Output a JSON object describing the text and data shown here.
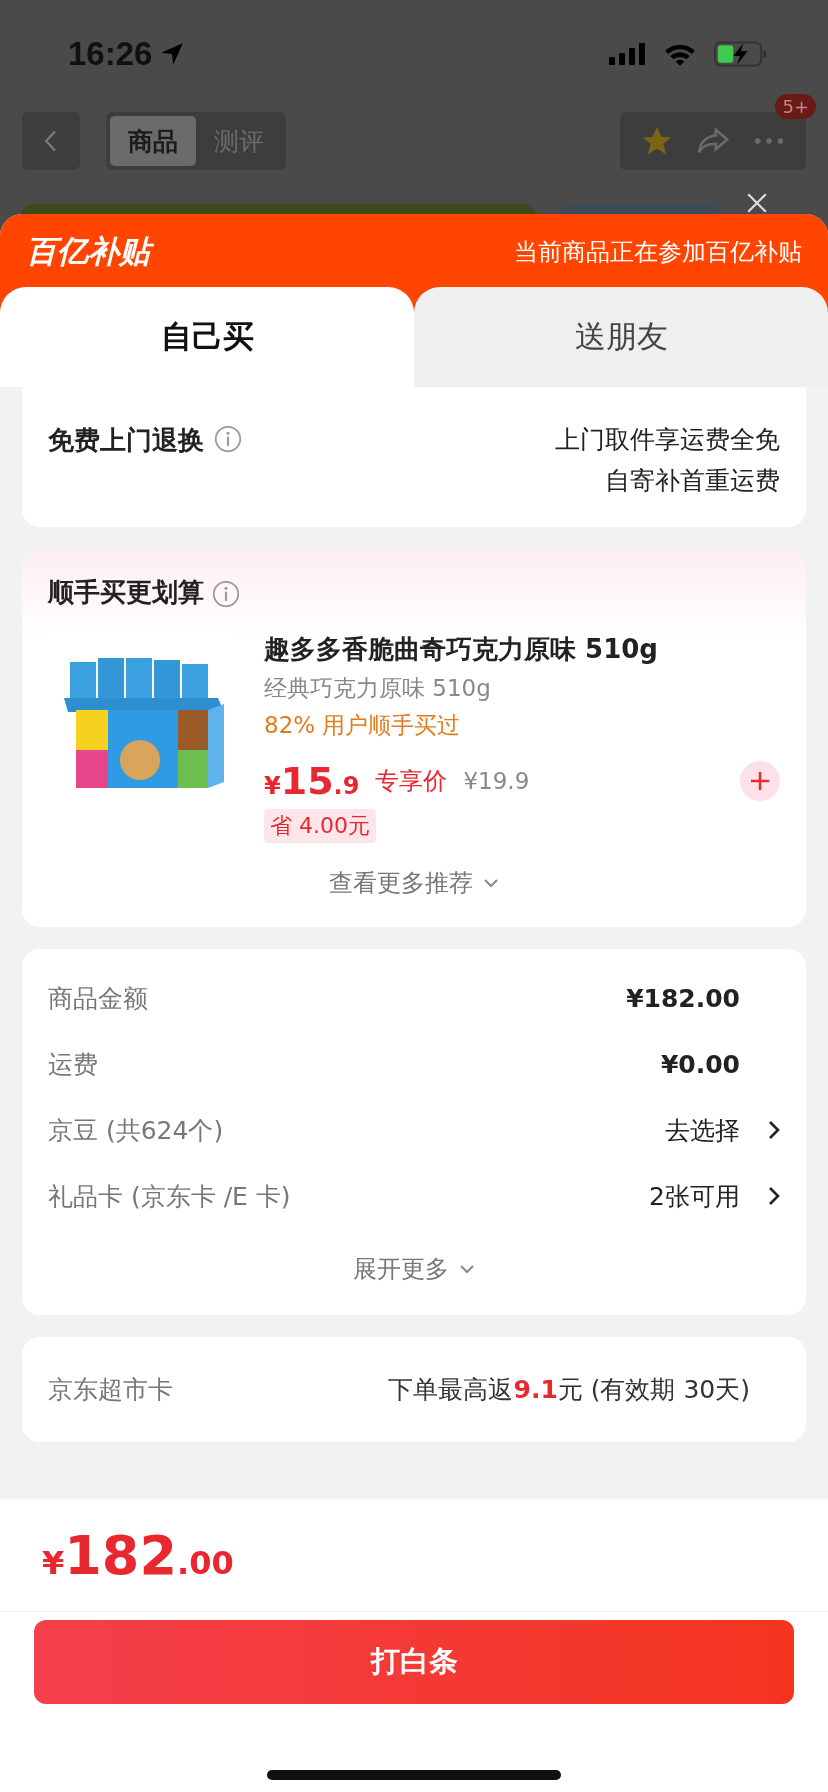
{
  "status_bar": {
    "time": "16:26"
  },
  "nav": {
    "segments": [
      {
        "label": "商品",
        "selected": true
      },
      {
        "label": "测评",
        "selected": false
      }
    ],
    "badge": "5+"
  },
  "banner": {
    "logo": "百亿补贴",
    "text": "当前商品正在参加百亿补贴"
  },
  "tabs": [
    {
      "label": "自己买",
      "selected": true
    },
    {
      "label": "送朋友",
      "selected": false
    }
  ],
  "return_service": {
    "title": "免费上门退换",
    "lines": [
      "上门取件享运费全免",
      "自寄补首重运费"
    ]
  },
  "bundle": {
    "title": "顺手买更划算",
    "product": {
      "title": "趣多多香脆曲奇巧克力原味 510g",
      "spec": "经典巧克力原味 510g",
      "popularity": "82% 用户顺手买过",
      "currency": "¥",
      "price_int": "15",
      "price_dec": ".9",
      "price_label": "专享价",
      "original_price": "¥19.9",
      "saving": "省 4.00元"
    },
    "more": "查看更多推荐"
  },
  "summary": {
    "rows": [
      {
        "label": "商品金额",
        "value": "¥182.00",
        "kind": "amount"
      },
      {
        "label": "运费",
        "value": "¥0.00",
        "kind": "amount"
      },
      {
        "label": "京豆 (共624个)",
        "value": "去选择",
        "kind": "link"
      },
      {
        "label": "礼品卡 (京东卡 /E 卡)",
        "value": "2张可用",
        "kind": "link"
      }
    ],
    "expand": "展开更多"
  },
  "market_card": {
    "label": "京东超市卡",
    "text_before": "下单最高返",
    "highlight": "9.1",
    "text_after": "元 (有效期 30天)"
  },
  "total": {
    "currency": "¥",
    "int": "182",
    "dec": ".00"
  },
  "pay_button": "打白条"
}
